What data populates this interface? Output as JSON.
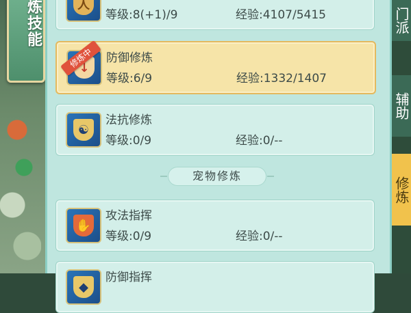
{
  "left_tab": {
    "label": "炼技能"
  },
  "right_tabs": [
    {
      "label": "门派"
    },
    {
      "label": "辅助"
    },
    {
      "label": "修炼"
    }
  ],
  "cards": [
    {
      "name": "",
      "level": "等级:8(+1)/9",
      "exp": "经验:4107/5415",
      "icon": "monk-icon"
    },
    {
      "name": "防御修炼",
      "badge": "修炼中",
      "level": "等级:6/9",
      "exp": "经验:1332/1407",
      "icon": "shield-sword-icon",
      "active": true
    },
    {
      "name": "法抗修炼",
      "level": "等级:0/9",
      "exp": "经验:0/--",
      "icon": "yin-yang-shield-icon"
    }
  ],
  "section_divider": {
    "label": "宠物修炼"
  },
  "pet_cards": [
    {
      "name": "攻法指挥",
      "level": "等级:0/9",
      "exp": "经验:0/--",
      "icon": "paw-icon"
    },
    {
      "name": "防御指挥",
      "level": "",
      "exp": "",
      "icon": "pet-shield-icon"
    }
  ]
}
